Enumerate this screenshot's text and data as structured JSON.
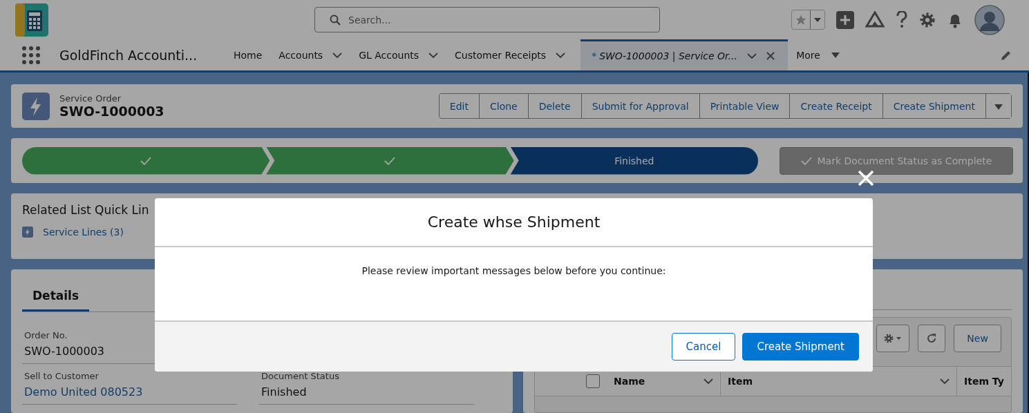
{
  "top_bar": {
    "search": {
      "placeholder": "Search..."
    }
  },
  "nav": {
    "app_name": "GoldFinch Accounti...",
    "tabs": [
      {
        "label": "Home",
        "menu": false,
        "selected": false,
        "closable": false
      },
      {
        "label": "Accounts",
        "menu": true,
        "selected": false,
        "closable": false
      },
      {
        "label": "GL Accounts",
        "menu": true,
        "selected": false,
        "closable": false
      },
      {
        "label": "Customer Receipts",
        "menu": true,
        "selected": false,
        "closable": false
      },
      {
        "prefix": "*",
        "label": "SWO-1000003 | Service Or...",
        "menu": true,
        "selected": true,
        "closable": true
      }
    ],
    "more": "More"
  },
  "record": {
    "object_type": "Service Order",
    "title": "SWO-1000003",
    "actions": [
      "Edit",
      "Clone",
      "Delete",
      "Submit for Approval",
      "Printable View",
      "Create Receipt",
      "Create Shipment"
    ]
  },
  "path": {
    "stages": [
      {
        "complete": true
      },
      {
        "complete": true
      },
      {
        "complete": false,
        "label": "Finished"
      }
    ],
    "mark_button": {
      "label": "Mark Document Status as Complete",
      "disabled": true
    }
  },
  "quick_links": {
    "title": "Related List Quick Lin",
    "links": [
      "Service Lines (3)"
    ]
  },
  "details": {
    "tabs": [
      {
        "label": "Details",
        "selected": true
      }
    ],
    "rows": [
      [
        {
          "label": "Order No.",
          "value": "SWO-1000003",
          "kind": "text"
        }
      ],
      [
        {
          "label": "Sell to Customer",
          "value": "Demo United 080523",
          "kind": "link"
        },
        {
          "label": "Document Status",
          "value": "Finished",
          "kind": "text"
        }
      ]
    ]
  },
  "related": {
    "new_button": "New",
    "table": {
      "select_all_checked": false,
      "columns": [
        "Name",
        "Item",
        "Item Ty"
      ]
    }
  },
  "modal": {
    "title": "Create whse Shipment",
    "message": "Please review important messages below before you continue:",
    "buttons": [
      {
        "label": "Cancel",
        "kind": "neutral"
      },
      {
        "label": "Create Shipment",
        "kind": "brand"
      }
    ]
  }
}
